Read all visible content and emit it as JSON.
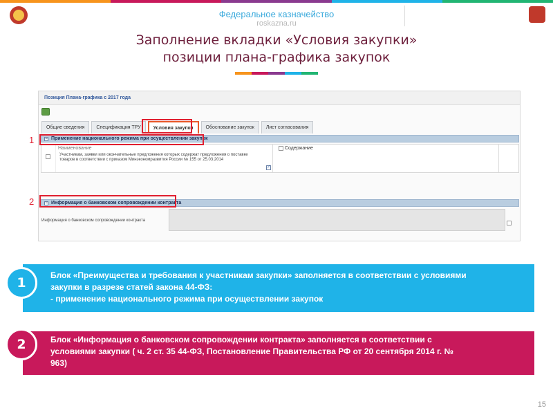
{
  "colors": {
    "stripe": [
      "#f7941d",
      "#c8195b",
      "#8a3a8f",
      "#1fb3e8",
      "#22b573"
    ],
    "title": "#6d1f3c",
    "accent_blue": "#1fb3e8",
    "accent_pink": "#c8195b",
    "highlight_red": "#e01f30"
  },
  "header": {
    "org_name": "Федеральное казначейство",
    "site": "roskazna.ru",
    "logo_icon": "emblem-icon"
  },
  "title": {
    "line1": "Заполнение вкладки «Условия закупки»",
    "line2": "позиции плана-графика закупок"
  },
  "screen": {
    "header_title": "Позиция Плана-графика с 2017 года",
    "tabs": [
      {
        "label": "Общие сведения",
        "active": false
      },
      {
        "label": "Спецификация ТРУ",
        "active": false
      },
      {
        "label": "Условия закупки",
        "active": true
      },
      {
        "label": "Обоснование закупок",
        "active": false
      },
      {
        "label": "Лист согласования",
        "active": false
      }
    ],
    "section1_title": "Применение национального режима при осуществлении закупок",
    "grid": {
      "col_name": "Наименование",
      "col_content": "Содержание",
      "row_text": "Участникам, заявки или окончательные предложения которых содержат предложения о поставке товаров в соответствии с приказом Минэкономразвития России № 155 от 25.03.2014",
      "row_checked": true
    },
    "section2_title": "Информация о банковском сопровождении контракта",
    "bank_label": "Информация о банковском сопровождении контракта"
  },
  "markers": [
    "1",
    "2"
  ],
  "blocks": [
    {
      "badge": "1",
      "lines": [
        "Блок «Преимущества и требования к участникам закупки» заполняется в соответствии с условиями",
        "закупки в разрезе статей закона 44-ФЗ:",
        " - применение национального режима при осуществлении закупок"
      ]
    },
    {
      "badge": "2",
      "lines": [
        "Блок «Информация о банковском сопровождении контракта» заполняется в соответствии с",
        "условиями закупки ( ч. 2 ст. 35 44-ФЗ, Постановление Правительства РФ от 20 сентября 2014 г. №",
        "963)"
      ]
    }
  ],
  "page_number": "15"
}
